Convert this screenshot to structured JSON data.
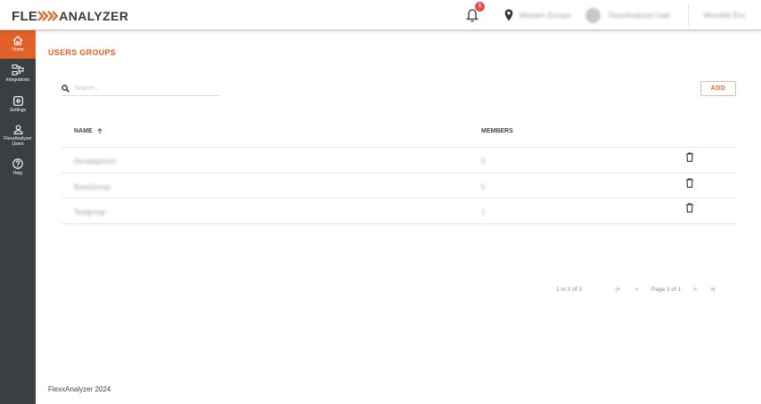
{
  "app": {
    "logo_prefix": "FLE",
    "logo_suffix": "ANALYZER",
    "brand_color": "#e0622a"
  },
  "header": {
    "notification_count": "1",
    "location_text": "Western Europe",
    "user_text": "FlexxAnalyzer User",
    "right_text": "Monolith Env"
  },
  "sidebar": {
    "items": [
      {
        "label": "Home",
        "icon": "home-icon"
      },
      {
        "label": "Integrations",
        "icon": "integrations-icon"
      },
      {
        "label": "Settings",
        "icon": "settings-icon"
      },
      {
        "label": "FlexxAnalyzer Users",
        "icon": "user-icon"
      },
      {
        "label": "Help",
        "icon": "help-icon"
      }
    ]
  },
  "main": {
    "title": "USERS GROUPS",
    "search_placeholder": "Search...",
    "add_label": "ADD",
    "columns": {
      "name": "NAME",
      "members": "MEMBERS"
    },
    "rows": [
      {
        "name": "Development",
        "members": "5"
      },
      {
        "name": "BaseGroup",
        "members": "5"
      },
      {
        "name": "Testgroup",
        "members": "1"
      }
    ],
    "pagination": {
      "count": "1 to 3 of 3",
      "page": "Page 1 of 1"
    }
  },
  "footer": {
    "text": "FlexxAnalyzer 2024"
  }
}
